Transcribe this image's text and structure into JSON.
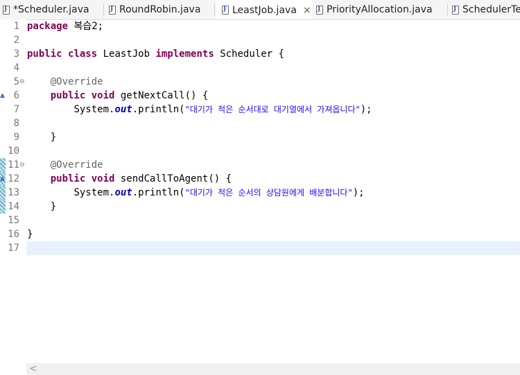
{
  "tabs": [
    {
      "label": "*Scheduler.java",
      "active": false
    },
    {
      "label": "RoundRobin.java",
      "active": false
    },
    {
      "label": "LeastJob.java",
      "active": true
    },
    {
      "label": "PriorityAllocation.java",
      "active": false
    },
    {
      "label": "SchedulerTe",
      "active": false
    }
  ],
  "close_glyph": "×",
  "line_numbers": [
    "1",
    "2",
    "3",
    "4",
    "5",
    "6",
    "7",
    "8",
    "9",
    "10",
    "11",
    "12",
    "13",
    "14",
    "15",
    "16",
    "17"
  ],
  "code": {
    "l1_kw": "package",
    "l1_rest": " 복습2;",
    "l3_kw1": "public",
    "l3_kw2": "class",
    "l3_name": " LeastJob ",
    "l3_kw3": "implements",
    "l3_rest": " Scheduler {",
    "l5_ann": "@Override",
    "l6_kw1": "public",
    "l6_kw2": "void",
    "l6_rest": " getNextCall() {",
    "l7_pre": "System.",
    "l7_field": "out",
    "l7_mid": ".println(",
    "l7_str": "\"대기가 적은 순서대로 대기열에서 가져옵니다\"",
    "l7_end": ");",
    "l9_brace": "}",
    "l11_ann": "@Override",
    "l12_kw1": "public",
    "l12_kw2": "void",
    "l12_rest": " sendCallToAgent() {",
    "l13_pre": "System.",
    "l13_field": "out",
    "l13_mid": ".println(",
    "l13_str": "\"대기가 적은 순서의 상담원에게 배분합니다\"",
    "l13_end": ");",
    "l14_brace": "}",
    "l16_brace": "}"
  },
  "scroll_arrow": "<",
  "colors": {
    "keyword": "#7f0055",
    "annotation": "#646464",
    "field": "#0000c0",
    "string": "#2a00ff",
    "current_line": "#e8f2fe"
  }
}
